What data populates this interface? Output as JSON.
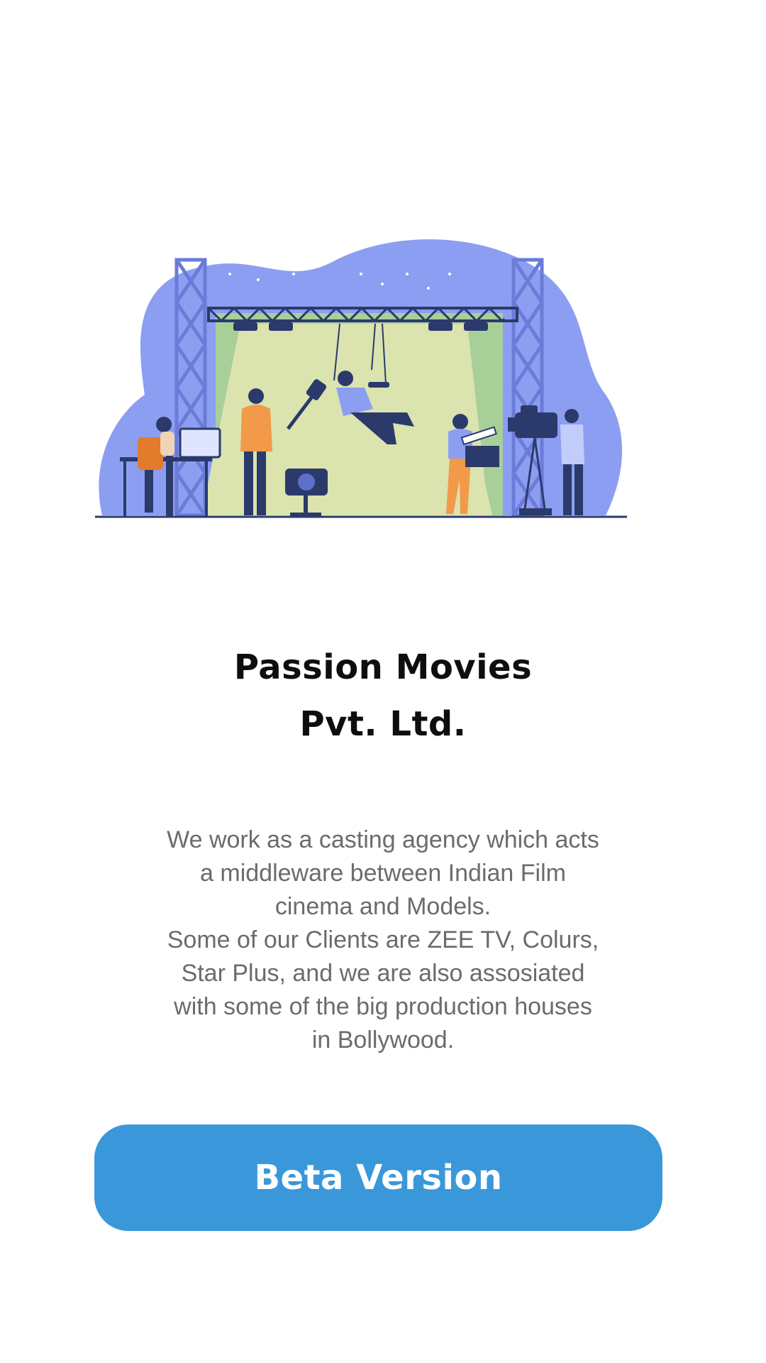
{
  "illustration": {
    "icon": "film-set-illustration"
  },
  "title": {
    "line1": "Passion Movies",
    "line2": "Pvt. Ltd."
  },
  "description": {
    "lines": [
      "We work as a casting agency which acts",
      "a middleware between Indian Film",
      "cinema and Models.",
      "Some of our Clients are ZEE TV, Colurs,",
      "Star Plus, and we are also assosiated",
      "with some of the big production houses",
      "in Bollywood."
    ]
  },
  "button": {
    "label": "Beta Version",
    "color": "#3a98da"
  },
  "colors": {
    "background": "#ffffff",
    "title": "#0e0e0e",
    "description": "#6b6b6b",
    "blob": "#8c9ef1",
    "stage": "#a9cf99"
  }
}
